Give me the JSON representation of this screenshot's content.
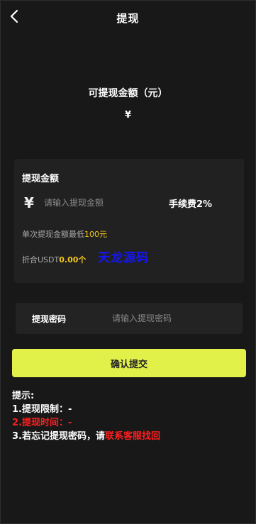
{
  "header": {
    "title": "提现",
    "back_icon": "chevron-left-icon"
  },
  "balance": {
    "label": "可提现金额（元）",
    "value": "¥"
  },
  "amount_card": {
    "title": "提现金额",
    "currency_symbol": "¥",
    "placeholder": "请输入提现金额",
    "fee": "手续费2%",
    "min_prefix": "单次提现金额最低",
    "min_value": "100元",
    "usdt_prefix": "折合USDT",
    "usdt_value": "0.00个",
    "watermark": "天龙源码"
  },
  "password": {
    "label": "提现密码",
    "placeholder": "请输入提现密码"
  },
  "submit_label": "确认提交",
  "tips": {
    "title": "提示:",
    "line1": "1.提现限制：-",
    "line2": "2.提现时间：-",
    "line3_prefix": "3.若忘记提现密码，请",
    "line3_link": "联系客服找回"
  },
  "colors": {
    "accent": "#e1f14a",
    "highlight": "#f0c419",
    "danger": "#ff1f1f",
    "background": "#181818"
  }
}
